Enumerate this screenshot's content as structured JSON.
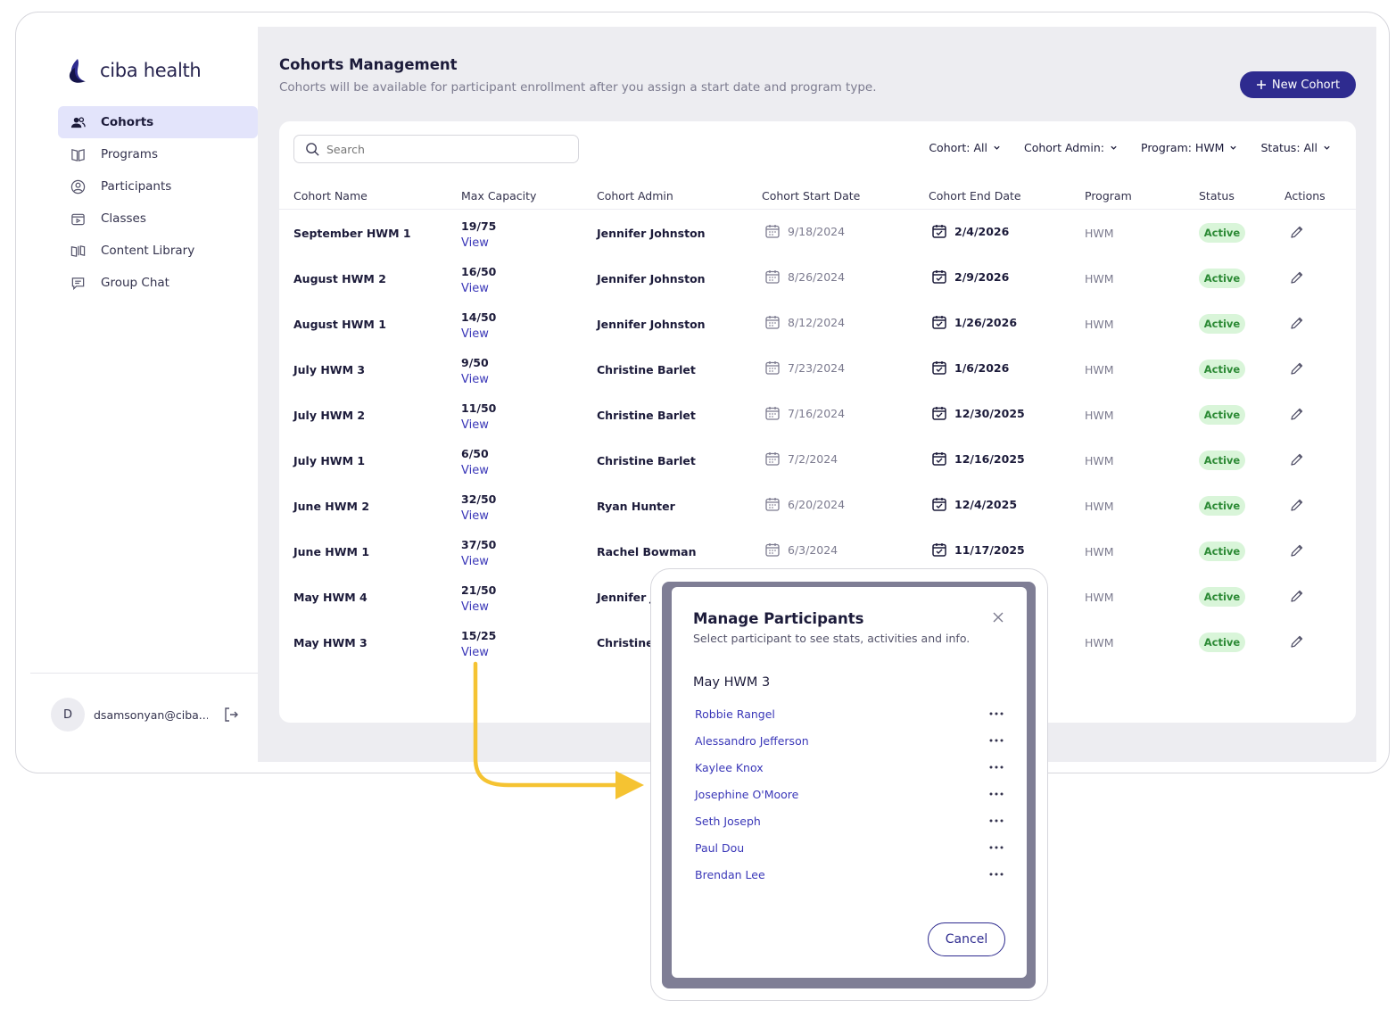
{
  "brand": {
    "name": "ciba health"
  },
  "sidebar": {
    "items": [
      {
        "label": "Cohorts",
        "icon": "users-icon",
        "active": true
      },
      {
        "label": "Programs",
        "icon": "book-icon",
        "active": false
      },
      {
        "label": "Participants",
        "icon": "person-circle-icon",
        "active": false
      },
      {
        "label": "Classes",
        "icon": "video-class-icon",
        "active": false
      },
      {
        "label": "Content Library",
        "icon": "library-icon",
        "active": false
      },
      {
        "label": "Group Chat",
        "icon": "chat-icon",
        "active": false
      }
    ],
    "user": {
      "initial": "D",
      "email": "dsamsonyan@ciba..."
    }
  },
  "header": {
    "title": "Cohorts Management",
    "subtitle": "Cohorts will be available for participant enrollment after you assign a start date and program type.",
    "new_button": "New Cohort"
  },
  "search": {
    "placeholder": "Search"
  },
  "filters": [
    "Cohort: All",
    "Cohort Admin:",
    "Program: HWM",
    "Status: All"
  ],
  "table": {
    "columns": [
      "Cohort Name",
      "Max Capacity",
      "Cohort Admin",
      "Cohort Start Date",
      "Cohort End Date",
      "Program",
      "Status",
      "Actions"
    ],
    "view_label": "View",
    "rows": [
      {
        "name": "September HWM 1",
        "capacity": "19/75",
        "admin": "Jennifer Johnston",
        "start": "9/18/2024",
        "end": "2/4/2026",
        "program": "HWM",
        "status": "Active"
      },
      {
        "name": "August HWM 2",
        "capacity": "16/50",
        "admin": "Jennifer Johnston",
        "start": "8/26/2024",
        "end": "2/9/2026",
        "program": "HWM",
        "status": "Active"
      },
      {
        "name": "August HWM 1",
        "capacity": "14/50",
        "admin": "Jennifer Johnston",
        "start": "8/12/2024",
        "end": "1/26/2026",
        "program": "HWM",
        "status": "Active"
      },
      {
        "name": "July HWM 3",
        "capacity": "9/50",
        "admin": "Christine Barlet",
        "start": "7/23/2024",
        "end": "1/6/2026",
        "program": "HWM",
        "status": "Active"
      },
      {
        "name": "July HWM 2",
        "capacity": "11/50",
        "admin": "Christine Barlet",
        "start": "7/16/2024",
        "end": "12/30/2025",
        "program": "HWM",
        "status": "Active"
      },
      {
        "name": "July HWM 1",
        "capacity": "6/50",
        "admin": "Christine Barlet",
        "start": "7/2/2024",
        "end": "12/16/2025",
        "program": "HWM",
        "status": "Active"
      },
      {
        "name": "June HWM 2",
        "capacity": "32/50",
        "admin": "Ryan Hunter",
        "start": "6/20/2024",
        "end": "12/4/2025",
        "program": "HWM",
        "status": "Active"
      },
      {
        "name": "June HWM 1",
        "capacity": "37/50",
        "admin": "Rachel Bowman",
        "start": "6/3/2024",
        "end": "11/17/2025",
        "program": "HWM",
        "status": "Active"
      },
      {
        "name": "May HWM 4",
        "capacity": "21/50",
        "admin": "Jennifer J",
        "start": "",
        "end": "",
        "program": "HWM",
        "status": "Active"
      },
      {
        "name": "May HWM 3",
        "capacity": "15/25",
        "admin": "Christine I",
        "start": "",
        "end": "",
        "program": "HWM",
        "status": "Active"
      }
    ]
  },
  "modal": {
    "title": "Manage Participants",
    "subtitle": "Select participant to see stats, activities and info.",
    "cohort": "May HWM 3",
    "participants": [
      "Robbie Rangel",
      "Alessandro Jefferson",
      "Kaylee Knox",
      "Josephine O'Moore",
      "Seth Joseph",
      "Paul Dou",
      "Brendan Lee"
    ],
    "cancel": "Cancel"
  },
  "colors": {
    "accent": "#2e2b8f",
    "link": "#3a37b8",
    "active_bg": "#d9f5d9",
    "active_text": "#2c8a35",
    "highlight": "#f5c332"
  }
}
